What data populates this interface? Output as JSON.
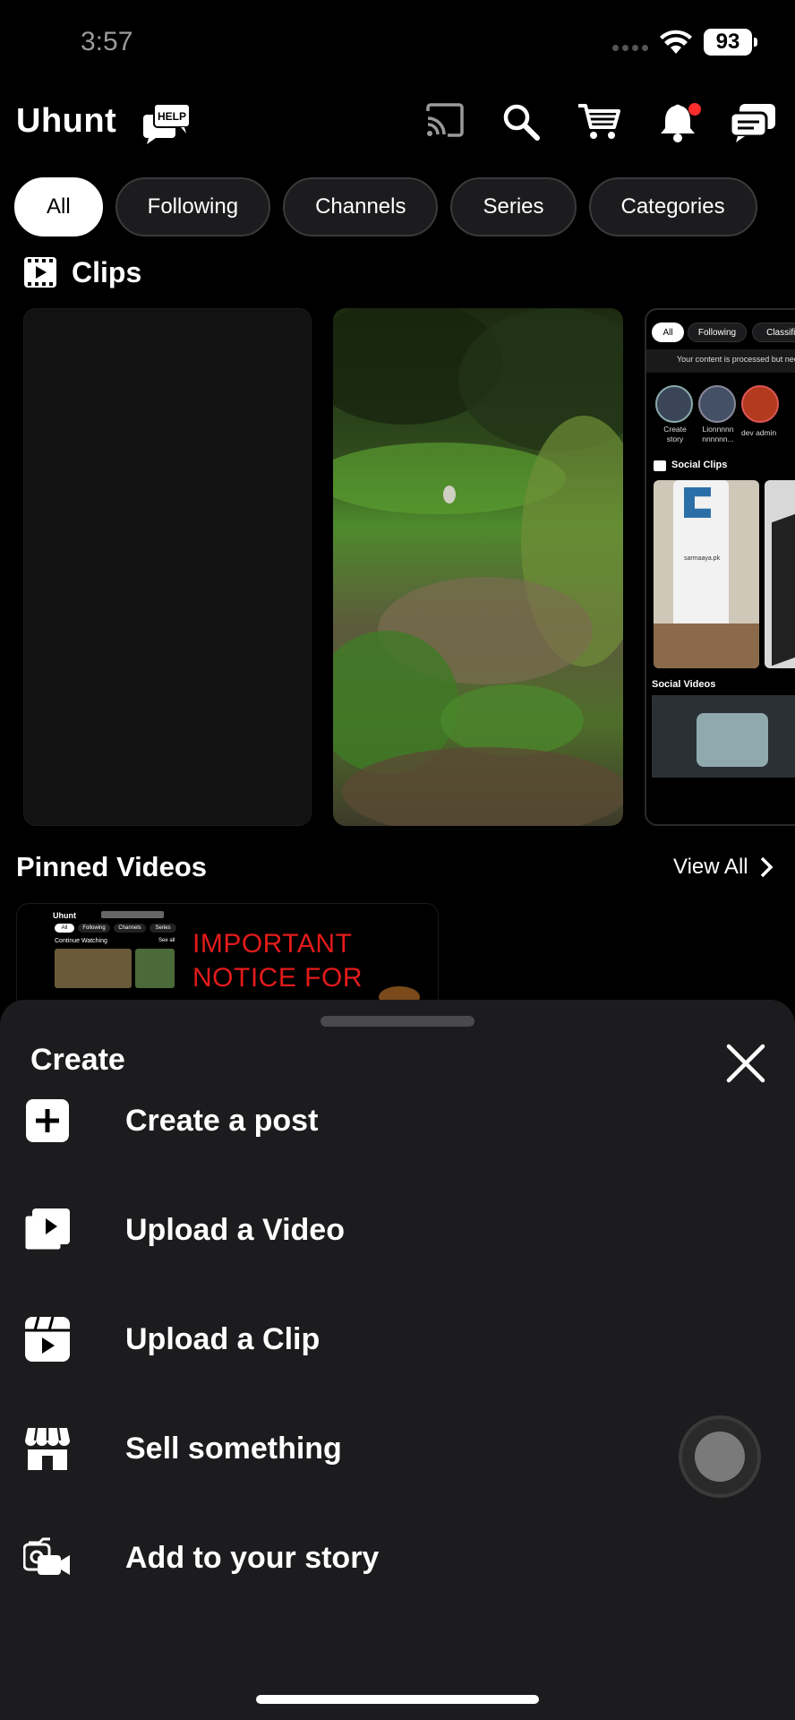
{
  "status_bar": {
    "time": "3:57",
    "battery": "93"
  },
  "header": {
    "logo": "Uhunt",
    "help_badge": "HELP"
  },
  "chips": [
    "All",
    "Following",
    "Channels",
    "Series",
    "Categories"
  ],
  "clips": {
    "title": "Clips",
    "preview": {
      "chips": [
        "All",
        "Following",
        "Classifie"
      ],
      "notice": "Your content is processed but need",
      "stories": [
        "Create story",
        "Lionnnnn nnnnnn...",
        "dev admin"
      ],
      "social_clips": "Social Clips",
      "bottle_text": "sarmaaya.pk",
      "social_videos": "Social Videos"
    }
  },
  "pinned": {
    "title": "Pinned Videos",
    "view_all": "View All",
    "thumb": {
      "mini_logo": "Uhunt",
      "mini_chips": [
        "All",
        "Following",
        "Channels",
        "Series"
      ],
      "continue": "Continue Watching",
      "see_all": "See all",
      "notice_lines": [
        "IMPORTANT",
        "NOTICE FOR"
      ]
    }
  },
  "sheet": {
    "title": "Create",
    "items": [
      {
        "label": "Create a post",
        "icon": "plus-square-icon"
      },
      {
        "label": "Upload a Video",
        "icon": "video-stack-icon"
      },
      {
        "label": "Upload a Clip",
        "icon": "clip-icon"
      },
      {
        "label": "Sell something",
        "icon": "storefront-icon"
      },
      {
        "label": "Add to your story",
        "icon": "camera-story-icon"
      }
    ]
  },
  "colors": {
    "accent_red": "#e31b1b",
    "sheet_bg": "#1c1c1e",
    "notification_dot": "#ff2d2d"
  }
}
